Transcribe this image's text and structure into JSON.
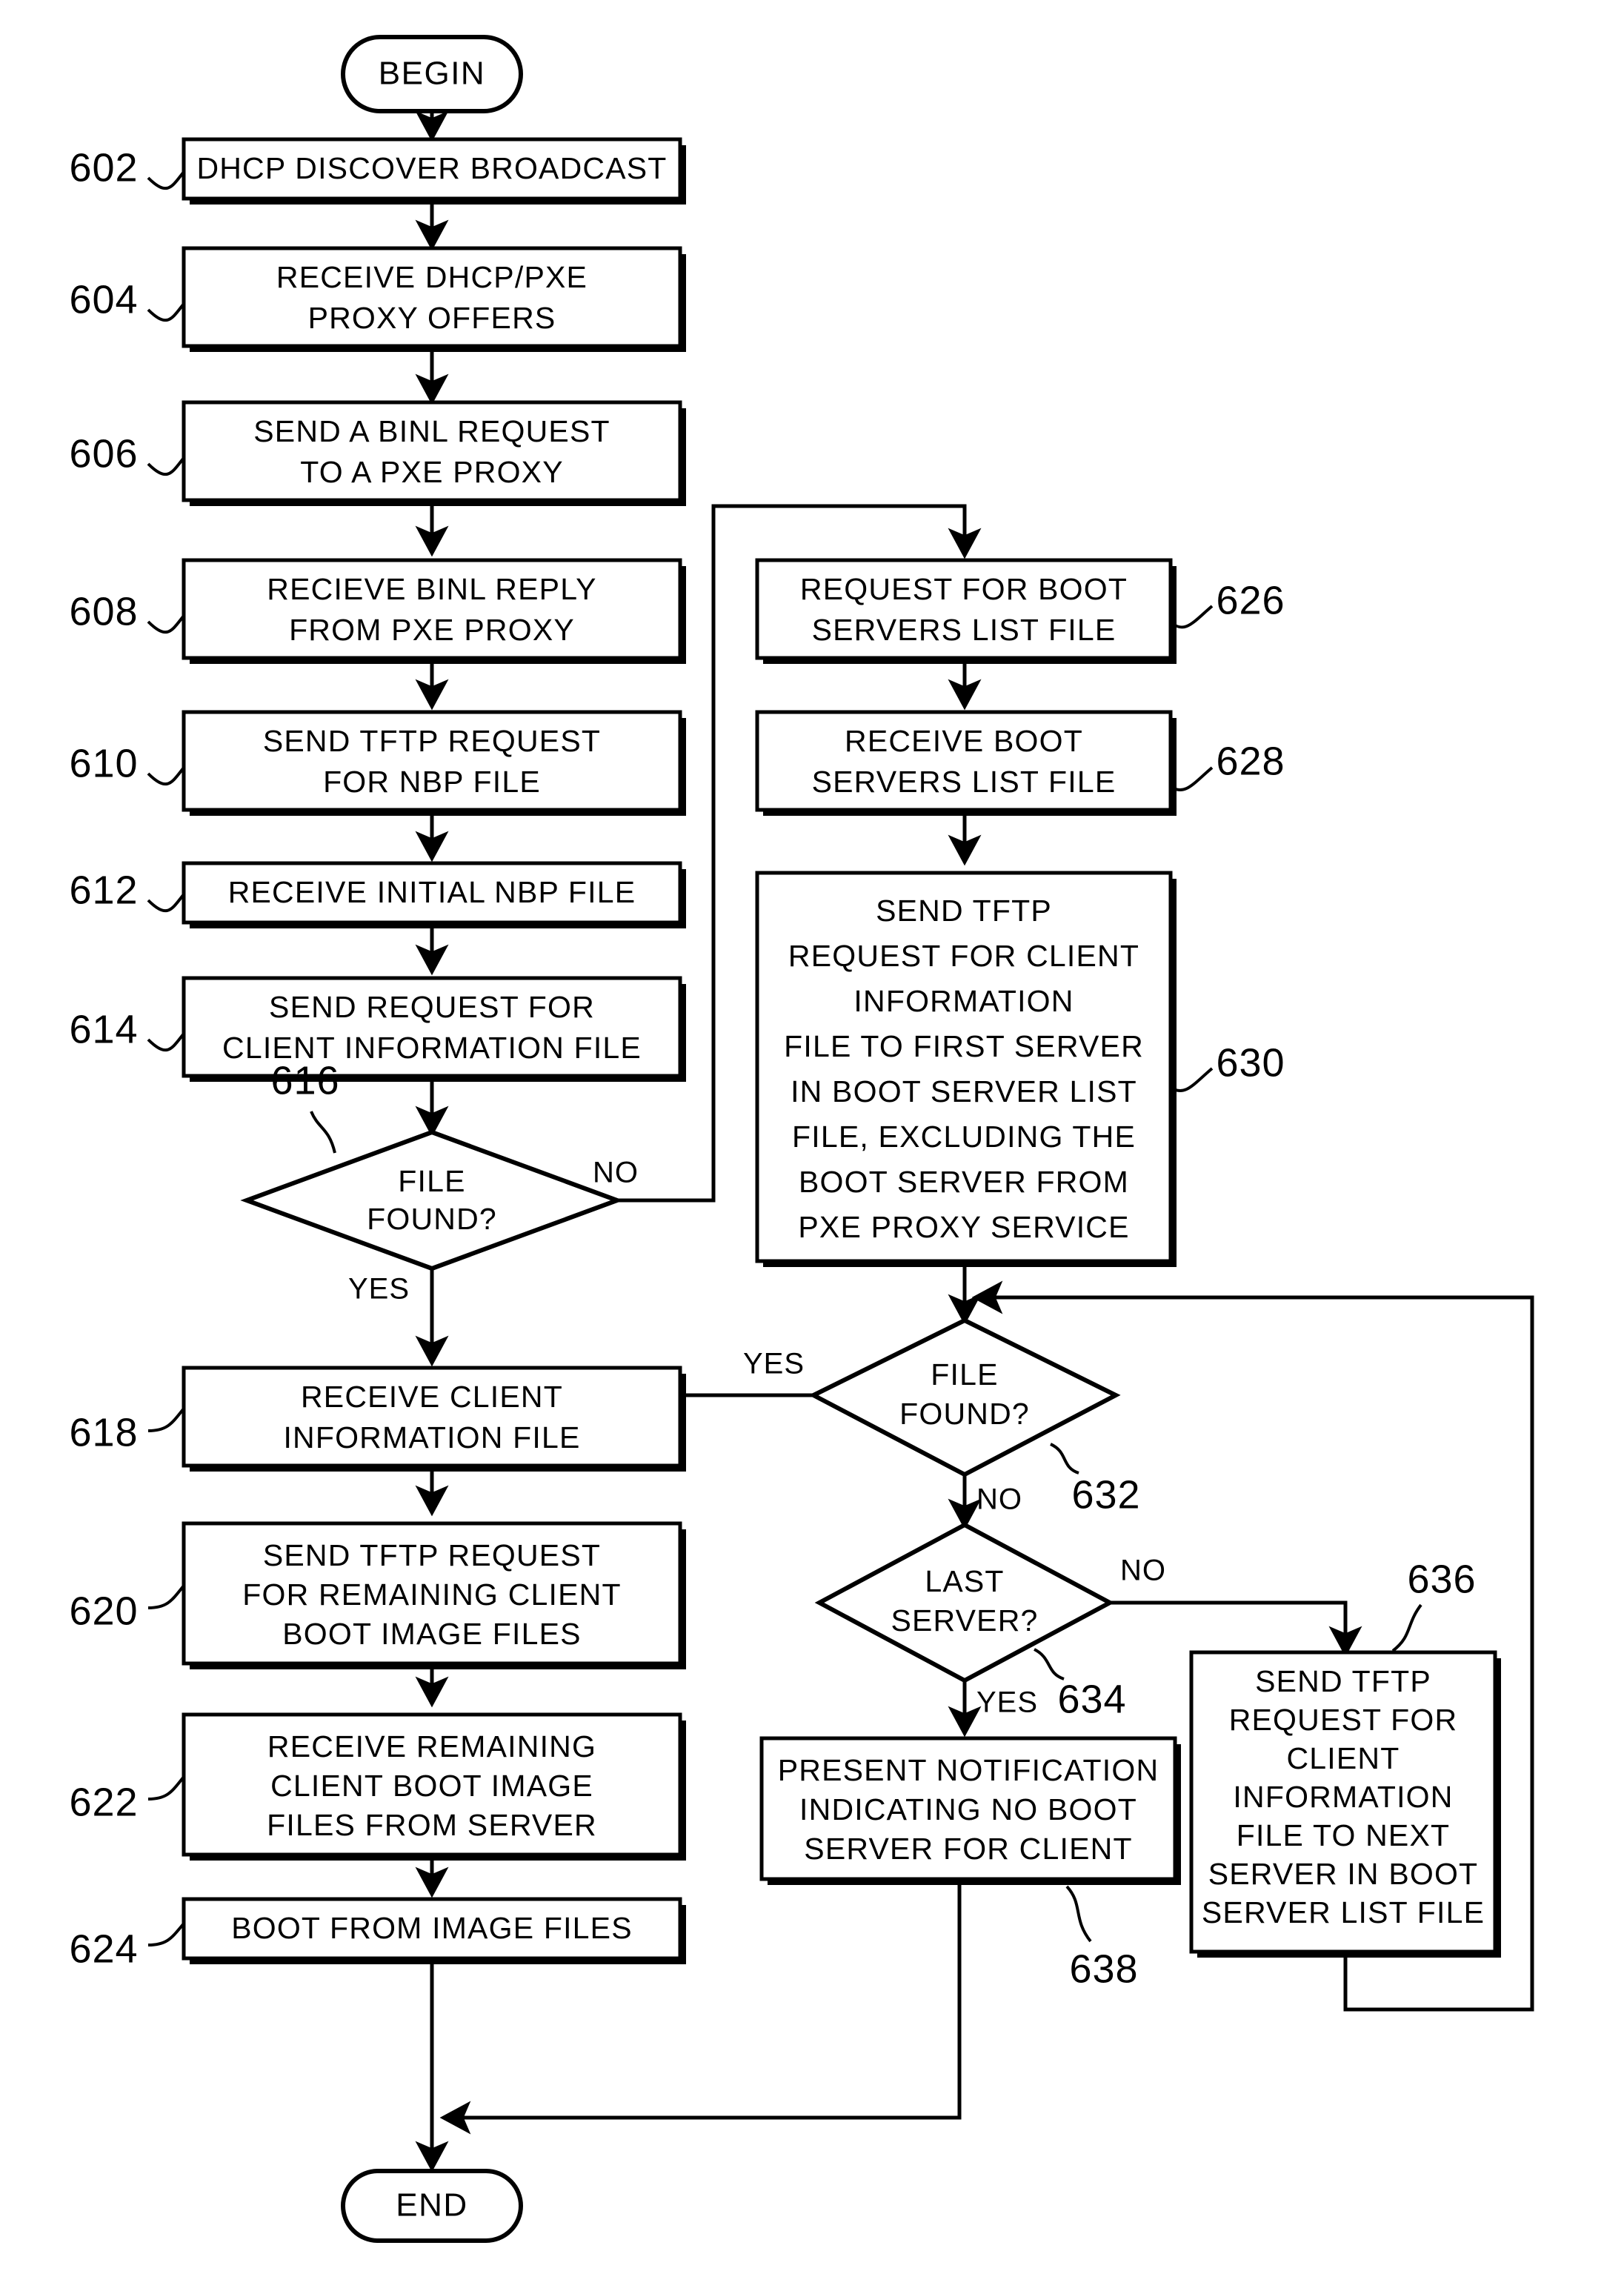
{
  "figure": {
    "type": "flowchart",
    "terminators": {
      "begin": "BEGIN",
      "end": "END"
    },
    "nodes": [
      {
        "ref": "602",
        "shape": "process",
        "lines": [
          "DHCP DISCOVER BROADCAST"
        ]
      },
      {
        "ref": "604",
        "shape": "process",
        "lines": [
          "RECEIVE DHCP/PXE",
          "PROXY OFFERS"
        ]
      },
      {
        "ref": "606",
        "shape": "process",
        "lines": [
          "SEND A BINL REQUEST",
          "TO A PXE PROXY"
        ]
      },
      {
        "ref": "608",
        "shape": "process",
        "lines": [
          "RECIEVE BINL REPLY",
          "FROM PXE PROXY"
        ]
      },
      {
        "ref": "610",
        "shape": "process",
        "lines": [
          "SEND TFTP REQUEST",
          "FOR NBP FILE"
        ]
      },
      {
        "ref": "612",
        "shape": "process",
        "lines": [
          "RECEIVE INITIAL NBP FILE"
        ]
      },
      {
        "ref": "614",
        "shape": "process",
        "lines": [
          "SEND REQUEST FOR",
          "CLIENT INFORMATION FILE"
        ]
      },
      {
        "ref": "616",
        "shape": "decision",
        "lines": [
          "FILE",
          "FOUND?"
        ]
      },
      {
        "ref": "618",
        "shape": "process",
        "lines": [
          "RECEIVE CLIENT",
          "INFORMATION FILE"
        ]
      },
      {
        "ref": "620",
        "shape": "process",
        "lines": [
          "SEND TFTP REQUEST",
          "FOR REMAINING CLIENT",
          "BOOT IMAGE FILES"
        ]
      },
      {
        "ref": "622",
        "shape": "process",
        "lines": [
          "RECEIVE REMAINING",
          "CLIENT BOOT IMAGE",
          "FILES FROM SERVER"
        ]
      },
      {
        "ref": "624",
        "shape": "process",
        "lines": [
          "BOOT FROM IMAGE FILES"
        ]
      },
      {
        "ref": "626",
        "shape": "process",
        "lines": [
          "REQUEST FOR BOOT",
          "SERVERS LIST FILE"
        ]
      },
      {
        "ref": "628",
        "shape": "process",
        "lines": [
          "RECEIVE BOOT",
          "SERVERS LIST FILE"
        ]
      },
      {
        "ref": "630",
        "shape": "process",
        "lines": [
          "SEND TFTP",
          "REQUEST FOR CLIENT",
          "INFORMATION",
          "FILE TO FIRST SERVER",
          "IN BOOT SERVER LIST",
          "FILE, EXCLUDING THE",
          "BOOT SERVER FROM",
          "PXE PROXY SERVICE"
        ]
      },
      {
        "ref": "632",
        "shape": "decision",
        "lines": [
          "FILE",
          "FOUND?"
        ]
      },
      {
        "ref": "634",
        "shape": "decision",
        "lines": [
          "LAST",
          "SERVER?"
        ]
      },
      {
        "ref": "636",
        "shape": "process",
        "lines": [
          "SEND TFTP",
          "REQUEST FOR",
          "CLIENT",
          "INFORMATION",
          "FILE TO NEXT",
          "SERVER IN BOOT",
          "SERVER LIST FILE"
        ]
      },
      {
        "ref": "638",
        "shape": "process",
        "lines": [
          "PRESENT NOTIFICATION",
          "INDICATING NO BOOT",
          "SERVER FOR CLIENT"
        ]
      }
    ],
    "branch_labels": {
      "d616_no": "NO",
      "d616_yes": "YES",
      "d632_yes": "YES",
      "d632_no": "NO",
      "d634_no": "NO",
      "d634_yes": "YES"
    },
    "colors": {
      "ink": "#000000",
      "paper": "#ffffff"
    }
  }
}
